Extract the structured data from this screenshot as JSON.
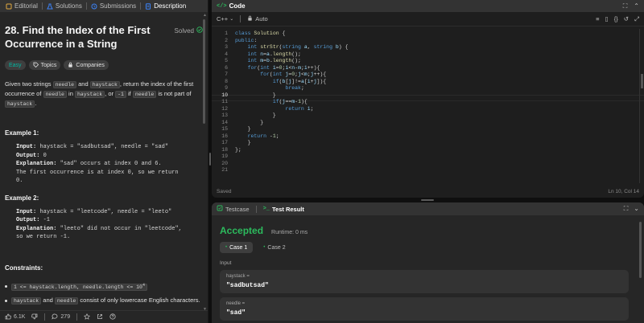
{
  "left_tabs": [
    {
      "label": "Editorial",
      "icon": "book-icon"
    },
    {
      "label": "Solutions",
      "icon": "flask-icon"
    },
    {
      "label": "Submissions",
      "icon": "history-icon"
    },
    {
      "label": "Description",
      "icon": "document-icon"
    }
  ],
  "problem": {
    "title": "28. Find the Index of the First Occurrence in a String",
    "status": "Solved",
    "difficulty": "Easy",
    "topics_label": "Topics",
    "companies_label": "Companies",
    "desc": {
      "t1": "Given two strings ",
      "c1": "needle",
      "t2": " and ",
      "c2": "haystack",
      "t3": ", return the index of the first occurrence of ",
      "c3": "needle",
      "t4": " in ",
      "c4": "haystack",
      "t5": ", or ",
      "c5": "-1",
      "t6": " if ",
      "c6": "needle",
      "t7": " is not part of ",
      "c7": "haystack",
      "t8": "."
    },
    "examples": [
      {
        "heading": "Example 1:",
        "input_label": "Input:",
        "input": " haystack = \"sadbutsad\", needle = \"sad\"",
        "output_label": "Output:",
        "output": " 0",
        "expl_label": "Explanation:",
        "expl": " \"sad\" occurs at index 0 and 6.\nThe first occurrence is at index 0, so we return\n0."
      },
      {
        "heading": "Example 2:",
        "input_label": "Input:",
        "input": " haystack = \"leetcode\", needle = \"leeto\"",
        "output_label": "Output:",
        "output": " -1",
        "expl_label": "Explanation:",
        "expl": " \"leeto\" did not occur in \"leetcode\",\nso we return -1."
      }
    ],
    "constraints_heading": "Constraints:",
    "constraint1_code": "1 <= haystack.length, needle.length <= 10",
    "constraint1_sup": "4",
    "constraint2_code_a": "haystack",
    "constraint2_t1": " and ",
    "constraint2_code_b": "needle",
    "constraint2_t2": " consist of only lowercase English characters."
  },
  "bottom_bar": {
    "likes": "6.1K",
    "comments": "279"
  },
  "code_panel": {
    "title": "Code",
    "language": "C++",
    "mode": "Auto",
    "saved": "Saved",
    "cursor": "Ln 10, Col 14",
    "line_numbers": [
      "1",
      "2",
      "3",
      "4",
      "5",
      "6",
      "7",
      "8",
      "9",
      "10",
      "11",
      "12",
      "13",
      "14",
      "15",
      "16",
      "17",
      "18",
      "19",
      "20",
      "21"
    ],
    "current_line": "10"
  },
  "test_panel": {
    "testcase_tab": "Testcase",
    "result_tab": "Test Result",
    "verdict": "Accepted",
    "runtime": "Runtime: 0 ms",
    "cases": [
      "Case 1",
      "Case 2"
    ],
    "input_label": "Input",
    "params": [
      {
        "name": "haystack =",
        "value": "\"sadbutsad\""
      },
      {
        "name": "needle =",
        "value": "\"sad\""
      }
    ]
  },
  "colors": {
    "accepted": "#2cbb5d",
    "easy": "#00b8a3",
    "keyword": "#569cd6"
  }
}
